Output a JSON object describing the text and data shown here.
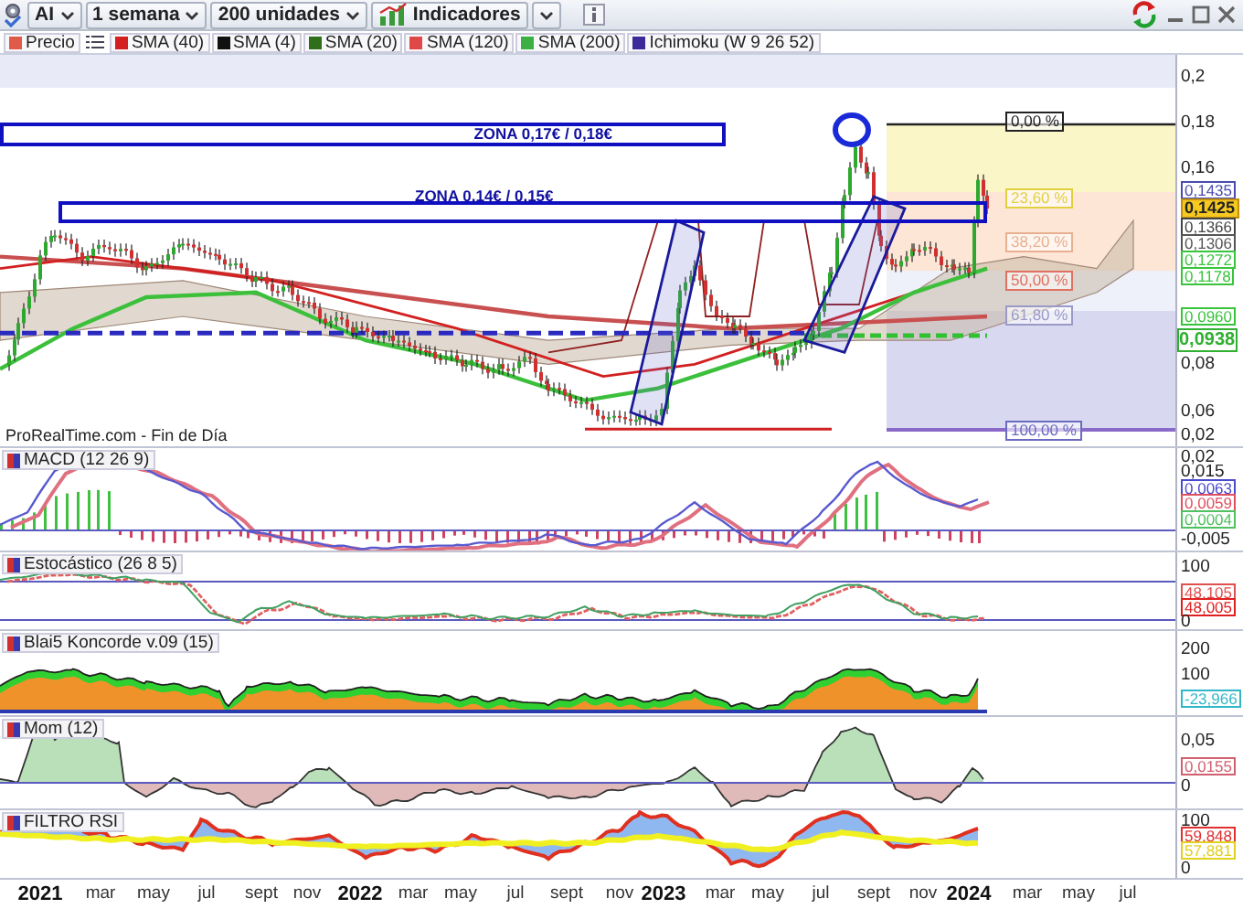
{
  "toolbar": {
    "symbol": "AI",
    "period": "1 semana",
    "units": "200 unidades",
    "indicators": "Indicadores"
  },
  "legend": [
    {
      "label": "Precio",
      "color": "#e05a4a"
    },
    {
      "label": "SMA (40)",
      "color": "#d42020"
    },
    {
      "label": "SMA (4)",
      "color": "#111111"
    },
    {
      "label": "SMA (20)",
      "color": "#2f6e1a"
    },
    {
      "label": "SMA (120)",
      "color": "#e04848"
    },
    {
      "label": "SMA (200)",
      "color": "#3cb043"
    },
    {
      "label": "Ichimoku (W 9 26 52)",
      "color": "#3a2a9a"
    }
  ],
  "main_chart": {
    "zones": [
      {
        "label": "ZONA 0,17€ / 0,18€"
      },
      {
        "label": "ZONA 0,14€ / 0,15€"
      }
    ],
    "fibonacci": [
      {
        "label": "0,00 %",
        "color": "#222222"
      },
      {
        "label": "23,60 %",
        "color": "#e0d040"
      },
      {
        "label": "38,20 %",
        "color": "#e8b090"
      },
      {
        "label": "50,00 %",
        "color": "#e07060"
      },
      {
        "label": "61,80 %",
        "color": "#9a9ac8"
      },
      {
        "label": "100,00 %",
        "color": "#6a6ac0"
      }
    ],
    "source": "ProRealTime.com - Fin de Día",
    "axis_labels": [
      {
        "text": "0,2",
        "kind": "tick"
      },
      {
        "text": "0,18",
        "kind": "tick"
      },
      {
        "text": "0,16",
        "kind": "tick"
      },
      {
        "text": "0,1435",
        "kind": "badge",
        "color": "#4a4ab0"
      },
      {
        "text": "0,1425",
        "kind": "current"
      },
      {
        "text": "0,1366",
        "kind": "badge",
        "color": "#444444"
      },
      {
        "text": "0,1306",
        "kind": "badge",
        "color": "#555555"
      },
      {
        "text": "0,1272",
        "kind": "badge",
        "color": "#39c43b"
      },
      {
        "text": "0,1178",
        "kind": "badge",
        "color": "#39c43b"
      },
      {
        "text": "0,0960",
        "kind": "badge",
        "color": "#39c43b"
      },
      {
        "text": "0,0938",
        "kind": "last"
      },
      {
        "text": "0,08",
        "kind": "tick"
      },
      {
        "text": "0,06",
        "kind": "tick"
      },
      {
        "text": "0,02",
        "kind": "tick"
      }
    ]
  },
  "panels": [
    {
      "kind": "macd",
      "title": "MACD (12 26 9)",
      "axis_labels": [
        {
          "text": "0,02",
          "kind": "tick"
        },
        {
          "text": "0,015",
          "kind": "tick"
        },
        {
          "text": "0,0063",
          "kind": "badge",
          "color": "#4a4ad0"
        },
        {
          "text": "0,0059",
          "kind": "badge",
          "color": "#e05060"
        },
        {
          "text": "0,0004",
          "kind": "badge",
          "color": "#50c060"
        },
        {
          "text": "-0,005",
          "kind": "tick"
        }
      ]
    },
    {
      "kind": "stochastic",
      "title": "Estocástico (26 8 5)",
      "axis_labels": [
        {
          "text": "100",
          "kind": "tick"
        },
        {
          "text": "48,105",
          "kind": "badge",
          "color": "#e05050"
        },
        {
          "text": "48,005",
          "kind": "badge",
          "color": "#e02020"
        },
        {
          "text": "0",
          "kind": "tick"
        }
      ]
    },
    {
      "kind": "koncorde",
      "title": "Blai5 Koncorde v.09 (15)",
      "axis_labels": [
        {
          "text": "200",
          "kind": "tick"
        },
        {
          "text": "100",
          "kind": "tick"
        },
        {
          "text": "-23,966",
          "kind": "badge",
          "color": "#30b8c8"
        }
      ]
    },
    {
      "kind": "momentum",
      "title": "Mom (12)",
      "axis_labels": [
        {
          "text": "0,05",
          "kind": "tick"
        },
        {
          "text": "0,0155",
          "kind": "badge",
          "color": "#d06070"
        },
        {
          "text": "0",
          "kind": "tick"
        }
      ]
    },
    {
      "kind": "rsi",
      "title": "FILTRO RSI",
      "axis_labels": [
        {
          "text": "100",
          "kind": "tick"
        },
        {
          "text": "59,848",
          "kind": "badge",
          "color": "#e03030"
        },
        {
          "text": "57,881",
          "kind": "badge",
          "color": "#e0d020"
        },
        {
          "text": "0",
          "kind": "tick"
        }
      ]
    }
  ],
  "x_axis": [
    {
      "text": "2021",
      "kind": "year"
    },
    {
      "text": "mar",
      "kind": "month"
    },
    {
      "text": "may",
      "kind": "month"
    },
    {
      "text": "jul",
      "kind": "month"
    },
    {
      "text": "sept",
      "kind": "month"
    },
    {
      "text": "nov",
      "kind": "month"
    },
    {
      "text": "2022",
      "kind": "year"
    },
    {
      "text": "mar",
      "kind": "month"
    },
    {
      "text": "may",
      "kind": "month"
    },
    {
      "text": "jul",
      "kind": "month"
    },
    {
      "text": "sept",
      "kind": "month"
    },
    {
      "text": "nov",
      "kind": "month"
    },
    {
      "text": "2023",
      "kind": "year"
    },
    {
      "text": "mar",
      "kind": "month"
    },
    {
      "text": "may",
      "kind": "month"
    },
    {
      "text": "jul",
      "kind": "month"
    },
    {
      "text": "sept",
      "kind": "month"
    },
    {
      "text": "nov",
      "kind": "month"
    },
    {
      "text": "2024",
      "kind": "year"
    },
    {
      "text": "mar",
      "kind": "month"
    },
    {
      "text": "may",
      "kind": "month"
    },
    {
      "text": "jul",
      "kind": "month"
    }
  ]
}
